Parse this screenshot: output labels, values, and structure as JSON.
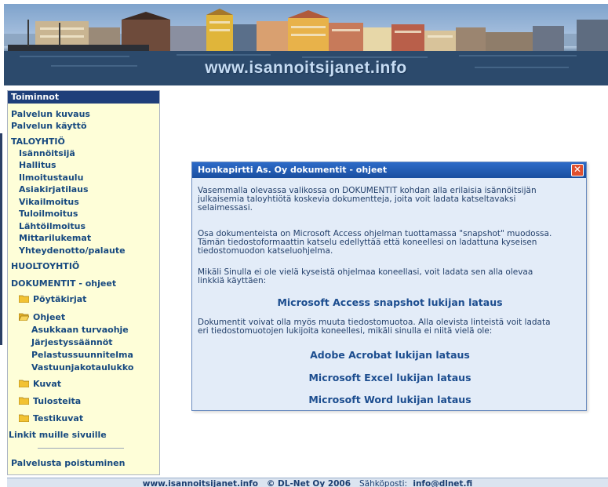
{
  "banner": {
    "text": "www.isannoitsijanet.info"
  },
  "sidebar": {
    "header": "Toiminnot",
    "items": [
      {
        "label": "Palvelun kuvaus"
      },
      {
        "label": "Palvelun käyttö"
      },
      {
        "label": "TALOYHTIÖ"
      },
      {
        "label": "Isännöitsijä"
      },
      {
        "label": "Hallitus"
      },
      {
        "label": "Ilmoitustaulu"
      },
      {
        "label": "Asiakirjatilaus"
      },
      {
        "label": "Vikailmoitus"
      },
      {
        "label": "Tuloilmoitus"
      },
      {
        "label": "Lähtöilmoitus"
      },
      {
        "label": "Mittarilukemat"
      },
      {
        "label": "Yhteydenotto/palaute"
      },
      {
        "label": "HUOLTOYHTIÖ"
      },
      {
        "label": "DOKUMENTIT - ohjeet"
      },
      {
        "label": "Pöytäkirjat"
      },
      {
        "label": "Ohjeet"
      },
      {
        "label": "Asukkaan turvaohje"
      },
      {
        "label": "Järjestyssäännöt"
      },
      {
        "label": "Pelastussuunnitelma"
      },
      {
        "label": "Vastuunjakotaulukko"
      },
      {
        "label": "Kuvat"
      },
      {
        "label": "Tulosteita"
      },
      {
        "label": "Testikuvat"
      },
      {
        "label": "Linkit muille sivuille"
      },
      {
        "label": "Palvelusta poistuminen"
      }
    ]
  },
  "dialog": {
    "title": "Honkapirtti As. Oy dokumentit - ohjeet",
    "close": "✕",
    "p1": [
      "Vasemmalla olevassa valikossa on DOKUMENTIT kohdan alla erilaisia isännöitsijän",
      "julkaisemia taloyhtiötä koskevia dokumentteja, joita voit ladata katseltavaksi",
      "selaimessasi."
    ],
    "p2": [
      "Osa dokumenteista on Microsoft Access ohjelman tuottamassa \"snapshot\" muodossa.",
      "Tämän tiedostoformaattin katselu edellyttää että koneellesi on ladattuna kyseisen",
      "tiedostomuodon katseluohjelma."
    ],
    "p3": [
      "Mikäli Sinulla ei ole vielä kyseistä ohjelmaa koneellasi, voit ladata sen alla olevaa",
      "linkkiä käyttäen:"
    ],
    "link_access": "Microsoft Access snapshot lukijan lataus",
    "p4": [
      "Dokumentit voivat olla myös muuta tiedostomuotoa. Alla olevista linteistä voit ladata",
      "eri tiedostomuotojen lukijoita koneellesi, mikäli sinulla ei niitä vielä ole:"
    ],
    "link_acrobat": "Adobe Acrobat lukijan lataus",
    "link_excel": "Microsoft Excel lukijan lataus",
    "link_word": "Microsoft Word lukijan lataus"
  },
  "footer": {
    "site": "www.isannoitsijanet.info",
    "copyright": "© DL-Net Oy 2006",
    "email_label": "Sähköposti:",
    "email": "info@dlnet.fi"
  },
  "colors": {
    "sidebar_bg": "#fefed8",
    "header_bg": "#1f3f7a",
    "dialog_bg": "#e3ecf8",
    "link": "#1c4d8f"
  }
}
